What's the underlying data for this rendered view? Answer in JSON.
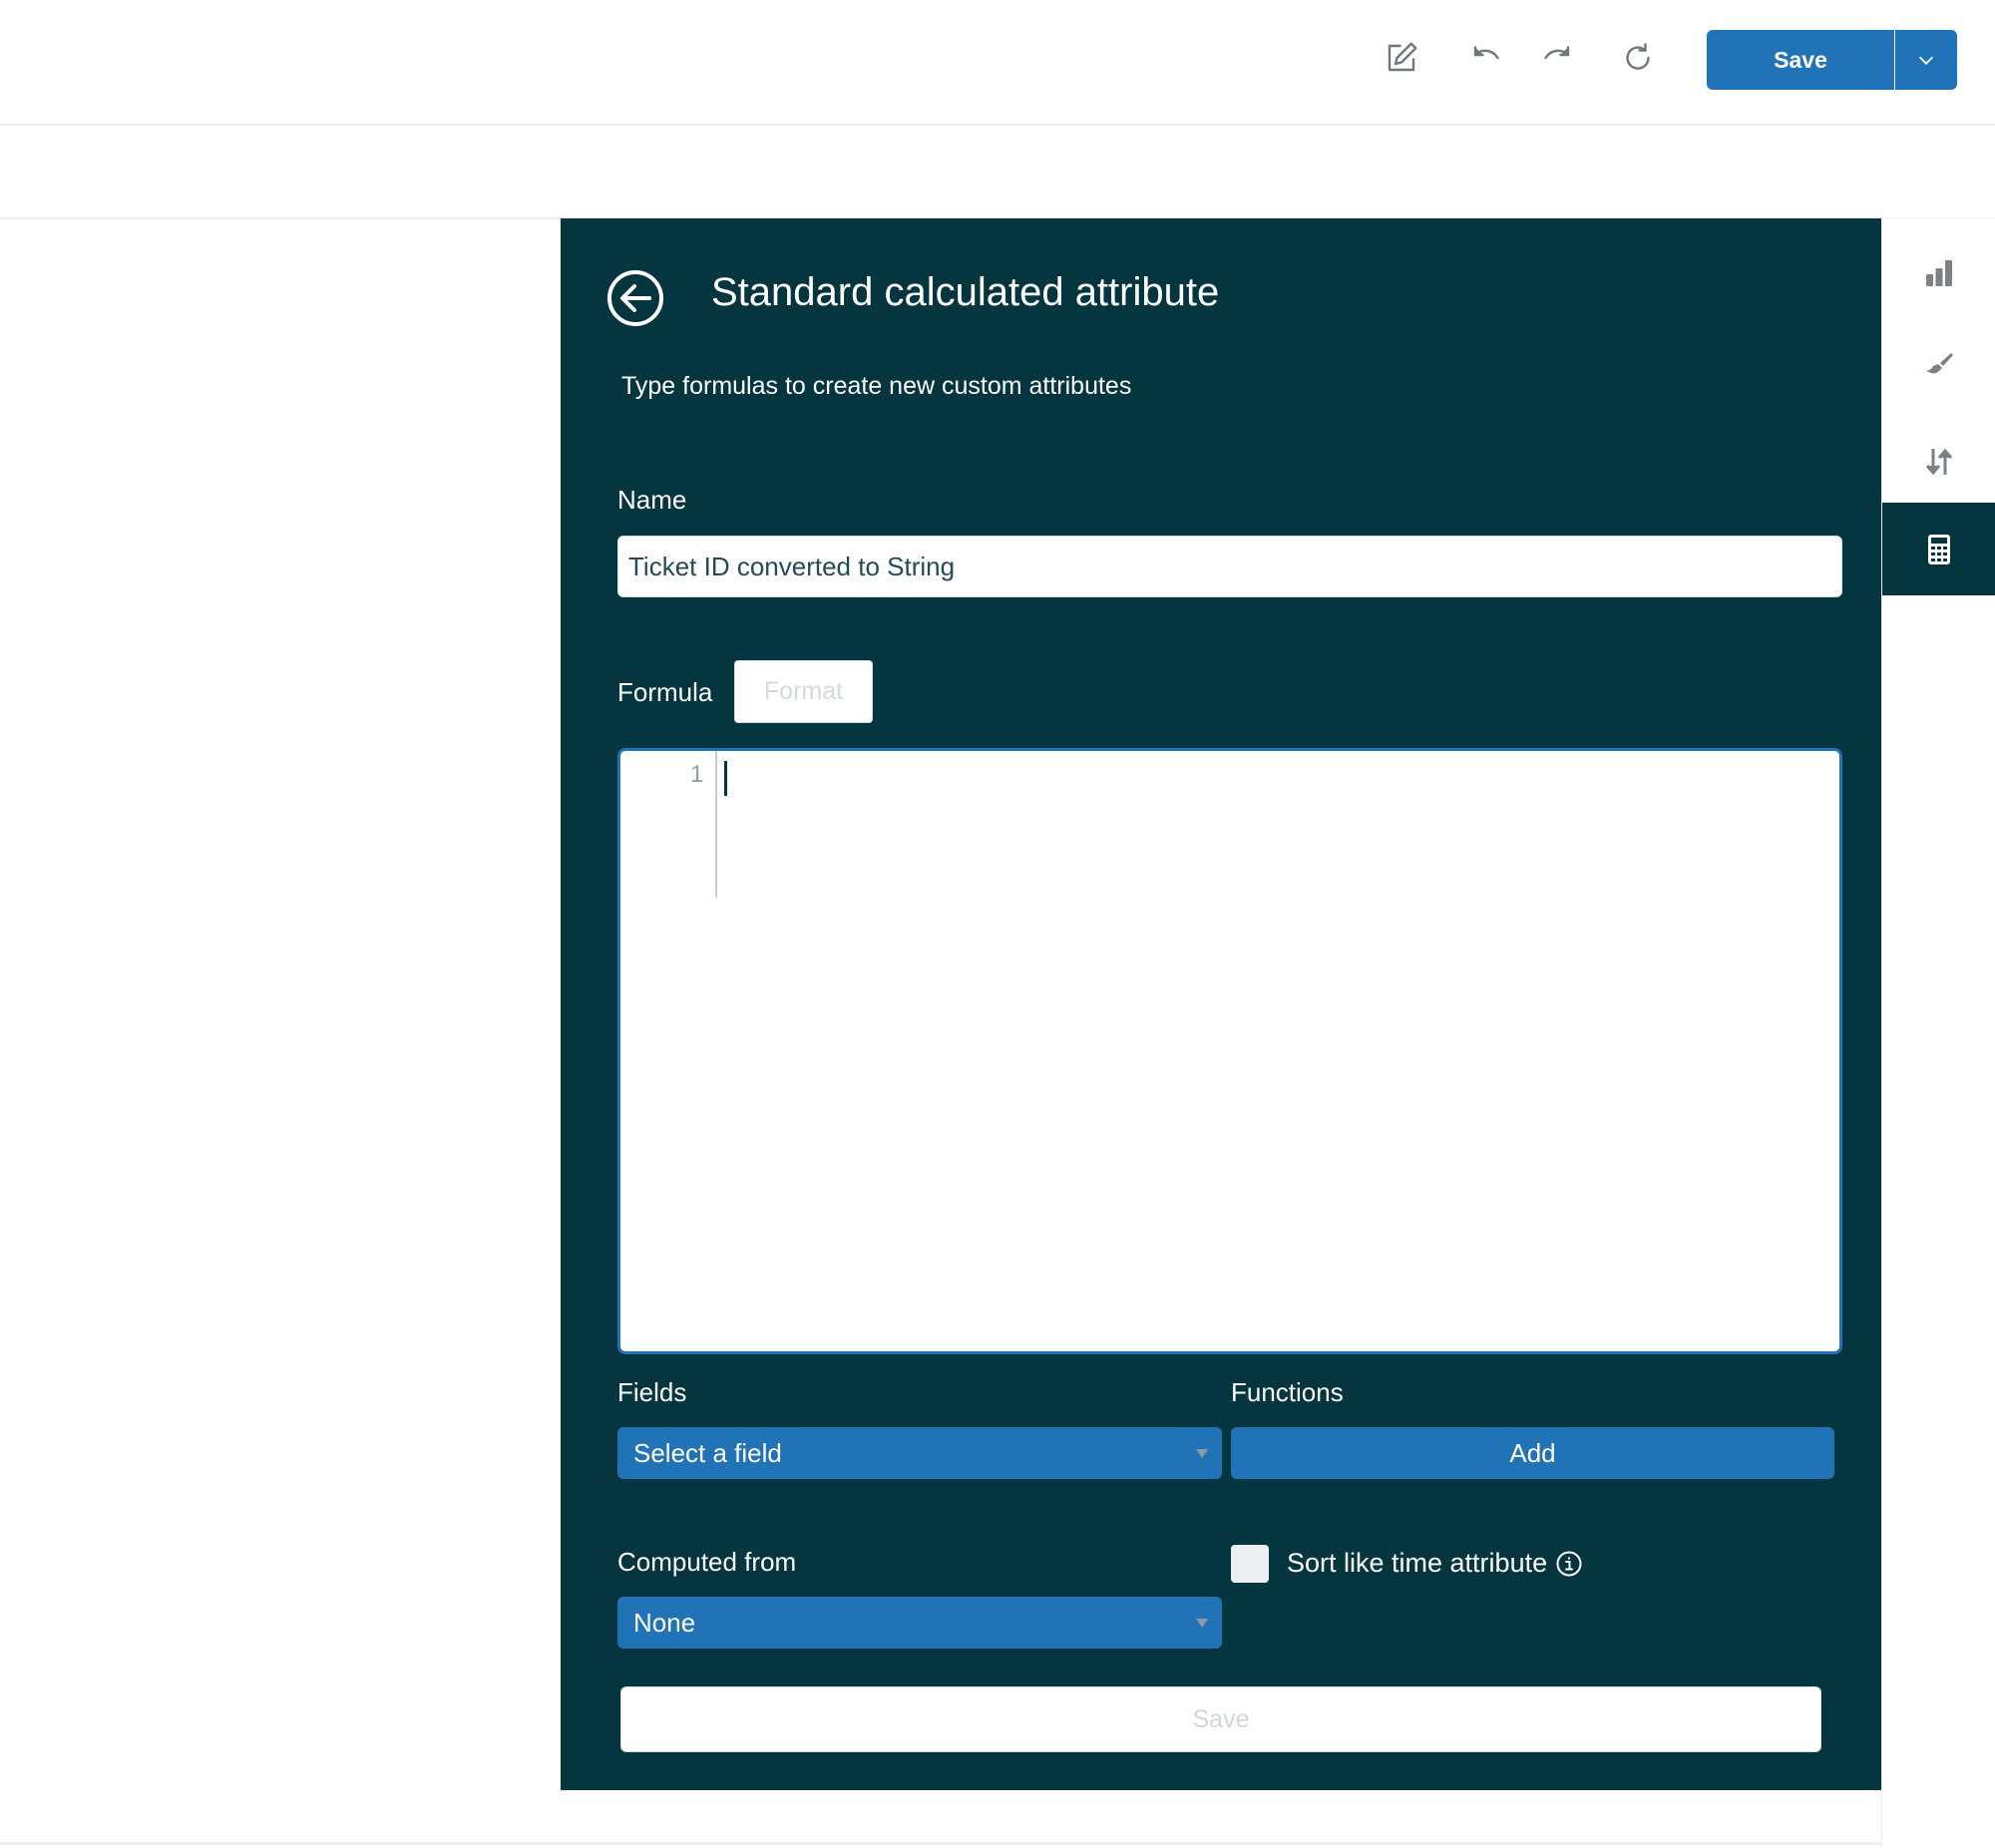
{
  "toolbar": {
    "icons": [
      "edit-icon",
      "undo-icon",
      "redo-icon",
      "refresh-icon"
    ],
    "save_label": "Save",
    "save_dropdown_icon": "chevron-down-icon"
  },
  "panel": {
    "back_icon": "arrow-left-circle-icon",
    "title": "Standard calculated attribute",
    "subtitle": "Type formulas to create new custom attributes",
    "name_label": "Name",
    "name_value": "Ticket ID converted to String",
    "formula_label": "Formula",
    "format_label": "Format",
    "editor": {
      "line_numbers": [
        "1"
      ],
      "content": ""
    },
    "fields_label": "Fields",
    "fields_select_value": "Select a field",
    "functions_label": "Functions",
    "add_label": "Add",
    "computed_from_label": "Computed from",
    "computed_from_value": "None",
    "sort_like_time_label": "Sort like time attribute",
    "sort_like_time_checked": false,
    "save_label": "Save"
  },
  "rail": {
    "items": [
      {
        "icon": "bar-chart-icon",
        "active": false
      },
      {
        "icon": "paintbrush-icon",
        "active": false
      },
      {
        "icon": "sort-arrows-icon",
        "active": false
      },
      {
        "icon": "calculator-icon",
        "active": true
      }
    ]
  },
  "colors": {
    "panel_bg": "#05353f",
    "accent": "#2173b8",
    "icon_gray": "#7b8287"
  }
}
